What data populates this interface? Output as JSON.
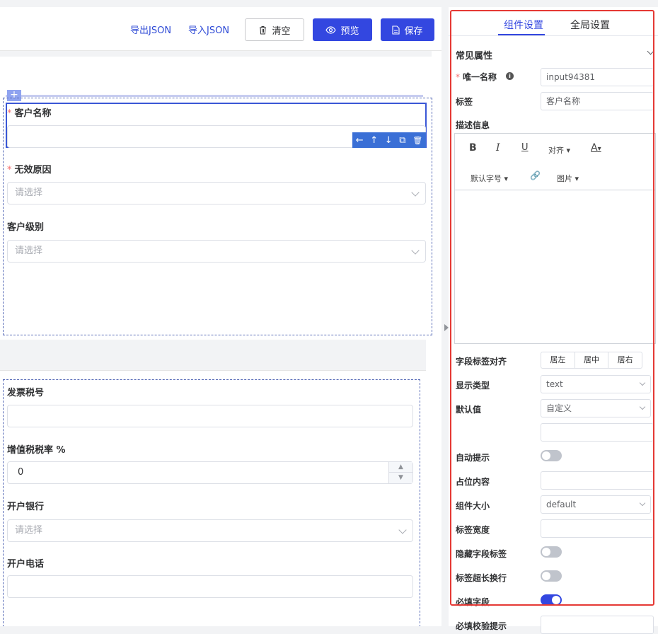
{
  "toolbar": {
    "export_json": "导出JSON",
    "import_json": "导入JSON",
    "clear": "清空",
    "preview": "预览",
    "save": "保存"
  },
  "canvas": {
    "plus": "+",
    "fields": [
      {
        "label": "客户名称",
        "required": true,
        "type": "input",
        "placeholder": ""
      },
      {
        "label": "无效原因",
        "required": true,
        "type": "select",
        "placeholder": "请选择"
      },
      {
        "label": "客户级别",
        "required": false,
        "type": "select",
        "placeholder": "请选择"
      },
      {
        "label": "发票税号",
        "required": false,
        "type": "input",
        "placeholder": ""
      },
      {
        "label": "增值税税率 %",
        "required": false,
        "type": "number",
        "value": "0"
      },
      {
        "label": "开户银行",
        "required": false,
        "type": "select",
        "placeholder": "请选择"
      },
      {
        "label": "开户电话",
        "required": false,
        "type": "input",
        "placeholder": ""
      }
    ],
    "required_mark": "*",
    "action_icons": [
      "arrow-left-icon",
      "arrow-up-icon",
      "arrow-down-icon",
      "copy-icon",
      "delete-icon"
    ],
    "action_glyphs": {
      "left": "←",
      "up": "↑",
      "down": "↓",
      "copy": "⧉",
      "delete": "🗑"
    },
    "stepper_up": "▲",
    "stepper_down": "▼"
  },
  "panel": {
    "tabs": [
      "组件设置",
      "全局设置"
    ],
    "section": "常见属性",
    "unique_name_label": "唯一名称",
    "unique_name_value": "input94381",
    "info_icon": "i",
    "label_label": "标签",
    "label_value": "客户名称",
    "desc_label": "描述信息",
    "editor": {
      "bold": "B",
      "italic": "I",
      "underline": "U",
      "align": "对齐",
      "font_color": "A",
      "font_size": "默认字号",
      "link": "🔗",
      "image": "图片",
      "caret": "▾"
    },
    "align_label": "字段标签对齐",
    "align_options": [
      "居左",
      "居中",
      "居右"
    ],
    "display_type_label": "显示类型",
    "display_type_value": "text",
    "default_label": "默认值",
    "default_value": "自定义",
    "autocomplete_label": "自动提示",
    "placeholder_label": "占位内容",
    "size_label": "组件大小",
    "size_value": "default",
    "label_width_label": "标签宽度",
    "hide_label_label": "隐藏字段标签",
    "wrap_label_label": "标签超长换行",
    "required_label": "必填字段",
    "required_msg_label": "必填校验提示"
  },
  "colors": {
    "primary": "#3347e0",
    "highlight": "#e53935",
    "required": "#f56c6c"
  }
}
